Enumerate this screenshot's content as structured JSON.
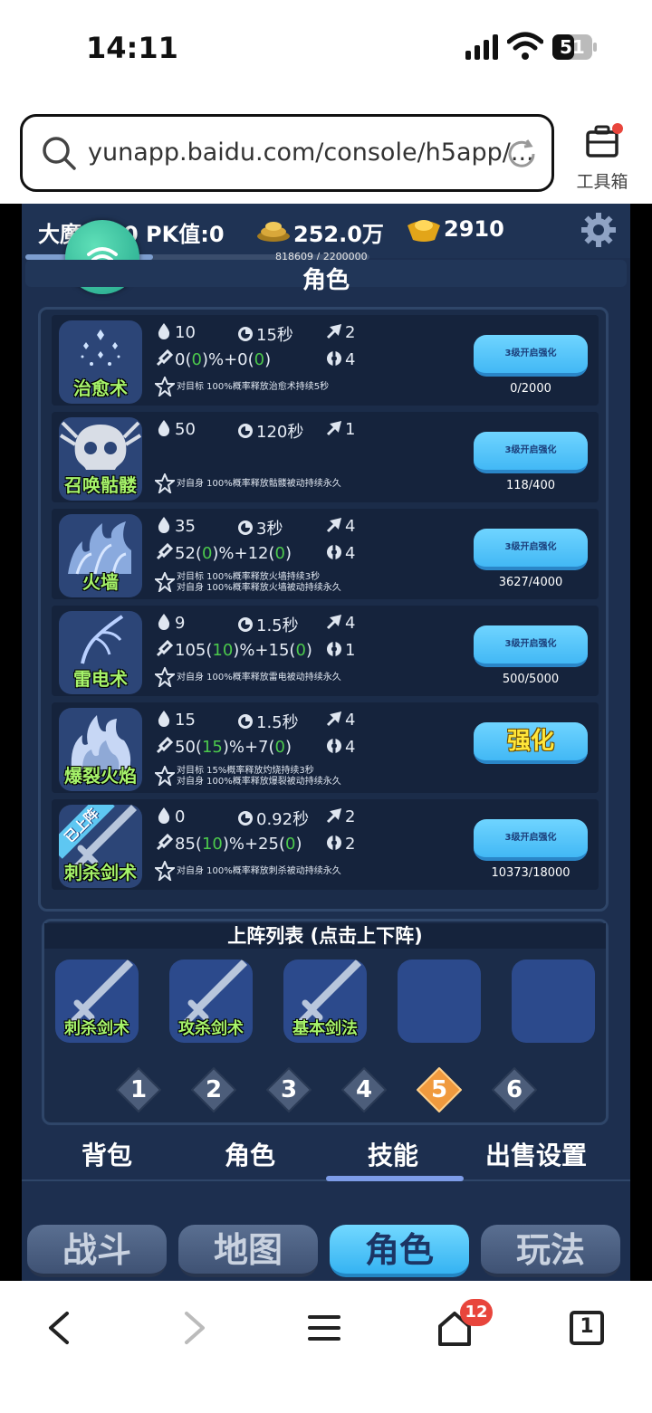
{
  "status_bar": {
    "time": "14:11",
    "battery": "51"
  },
  "browser": {
    "url": "yunapp.baidu.com/console/h5app/...",
    "toolbox_label": "工具箱",
    "tabs_count": "1",
    "notifications": "12"
  },
  "game": {
    "player": {
      "name_visible": "大魔",
      "name_tail": "0 PK值:0",
      "gold": "252.0万",
      "ingot": "2910",
      "exp_text": "818609 / 2200000",
      "exp_ratio": 0.372
    },
    "section_title": "角色",
    "skills": [
      {
        "name": "治愈术",
        "mp": "10",
        "cd": "15秒",
        "targets": "2",
        "power_base": "0",
        "power_bonus": "0",
        "power_mid": ")%+0(",
        "power_bonus2": "0",
        "range": "4",
        "desc": [
          "对目标 100%概率释放治愈术持续5秒"
        ],
        "button": "3级开启强化",
        "button_big": false,
        "progress": "0/2000"
      },
      {
        "name": "召唤骷髅",
        "mp": "50",
        "cd": "120秒",
        "targets": "1",
        "power_base": "",
        "power_bonus": "",
        "power_mid": "",
        "power_bonus2": "",
        "range": "",
        "desc": [
          "对自身 100%概率释放骷髅被动持续永久"
        ],
        "button": "3级开启强化",
        "button_big": false,
        "progress": "118/400"
      },
      {
        "name": "火墙",
        "mp": "35",
        "cd": "3秒",
        "targets": "4",
        "power_base": "52",
        "power_bonus": "0",
        "power_mid": ")%+12(",
        "power_bonus2": "0",
        "range": "4",
        "desc": [
          "对目标 100%概率释放火墙持续3秒",
          "对自身 100%概率释放火墙被动持续永久"
        ],
        "button": "3级开启强化",
        "button_big": false,
        "progress": "3627/4000"
      },
      {
        "name": "雷电术",
        "mp": "9",
        "cd": "1.5秒",
        "targets": "4",
        "power_base": "105",
        "power_bonus": "10",
        "power_mid": ")%+15(",
        "power_bonus2": "0",
        "range": "1",
        "desc": [
          "对自身 100%概率释放雷电被动持续永久"
        ],
        "button": "3级开启强化",
        "button_big": false,
        "progress": "500/5000"
      },
      {
        "name": "爆裂火焰",
        "mp": "15",
        "cd": "1.5秒",
        "targets": "4",
        "power_base": "50",
        "power_bonus": "15",
        "power_mid": ")%+7(",
        "power_bonus2": "0",
        "range": "4",
        "desc": [
          "对目标 15%概率释放灼烧持续3秒",
          "对自身 100%概率释放爆裂被动持续永久"
        ],
        "button": "强化",
        "button_big": true,
        "progress": ""
      },
      {
        "name": "刺杀剑术",
        "mp": "0",
        "cd": "0.92秒",
        "targets": "2",
        "power_base": "85",
        "power_bonus": "10",
        "power_mid": ")%+25(",
        "power_bonus2": "0",
        "range": "2",
        "desc": [
          "对自身 100%概率释放刺杀被动持续永久"
        ],
        "button": "3级开启强化",
        "button_big": false,
        "progress": "10373/18000",
        "ribbon": "已上阵"
      }
    ],
    "deploy": {
      "title": "上阵列表 (点击上下阵)",
      "slots": [
        "刺杀剑术",
        "攻杀剑术",
        "基本剑法",
        "",
        ""
      ],
      "pages": [
        "1",
        "2",
        "3",
        "4",
        "5",
        "6"
      ],
      "active_page": 4
    },
    "tabs": [
      "背包",
      "角色",
      "技能",
      "出售设置"
    ],
    "active_tab": 2,
    "main_nav": [
      "战斗",
      "地图",
      "角色",
      "玩法"
    ],
    "active_main": 2
  },
  "colors": {
    "panel": "#1b2c49",
    "accent_blue": "#42b8f5",
    "green_text": "#a6f36a",
    "active_page": "#f09a3e"
  }
}
